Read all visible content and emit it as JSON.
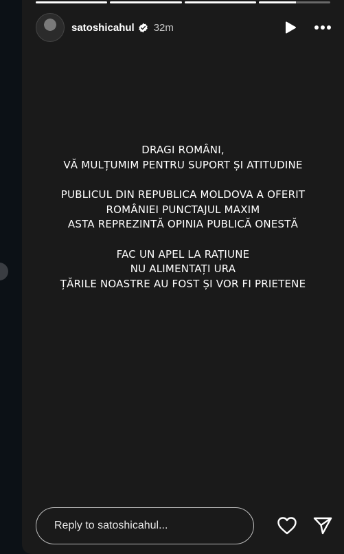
{
  "story": {
    "username": "satoshicahul",
    "time": "32m",
    "progress": [
      1,
      1,
      1,
      0.52
    ],
    "text_lines": [
      "DRAGI ROMÂNI,",
      "VĂ MULȚUMIM PENTRU SUPORT ȘI ATITUDINE",
      "",
      "PUBLICUL DIN REPUBLICA MOLDOVA A OFERIT",
      "ROMÂNIEI PUNCTAJUL MAXIM",
      "ASTA REPREZINTĂ OPINIA PUBLICĂ ONESTĂ",
      "",
      "FAC UN APEL LA RAȚIUNE",
      "NU ALIMENTAȚI URA",
      "ȚĂRILE NOASTRE AU FOST ȘI VOR FI PRIETENE"
    ]
  },
  "footer": {
    "reply_placeholder": "Reply to satoshicahul..."
  },
  "icons": {
    "play": "play-icon",
    "more": "more-options-icon",
    "verified": "verified-badge-icon",
    "like": "heart-icon",
    "share": "send-icon"
  },
  "colors": {
    "story_bg": "#1a1a1a",
    "page_bg": "#0d1117",
    "verified_fill": "#ffffff"
  }
}
